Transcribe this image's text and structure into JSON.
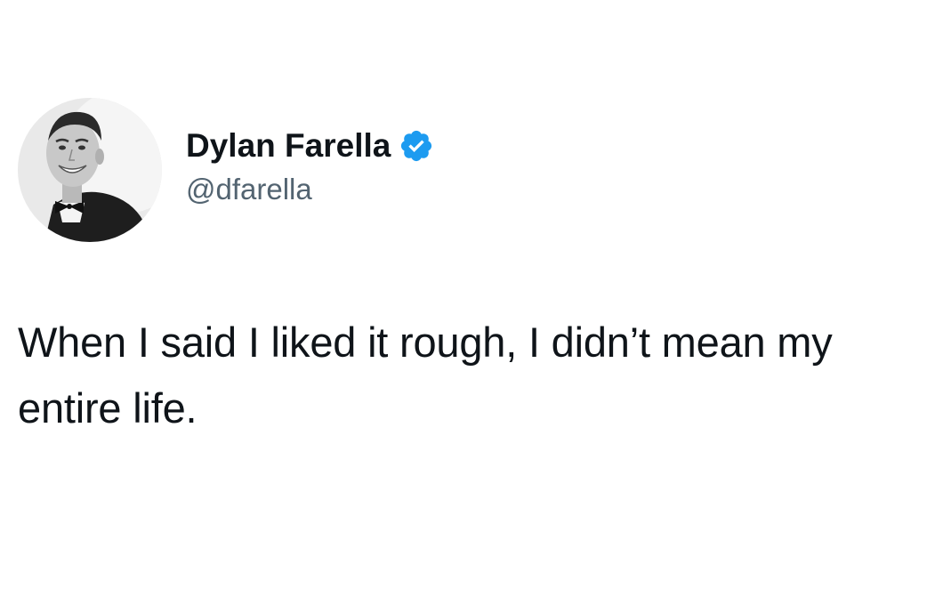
{
  "author": {
    "display_name": "Dylan Farella",
    "handle": "@dfarella",
    "verified": true,
    "avatar_icon": "profile-photo"
  },
  "tweet": {
    "text": "When I said I liked it rough, I didn’t mean my entire life."
  },
  "colors": {
    "text": "#0f1419",
    "handle": "#536471",
    "verified_badge": "#1d9bf0",
    "background": "#ffffff"
  }
}
